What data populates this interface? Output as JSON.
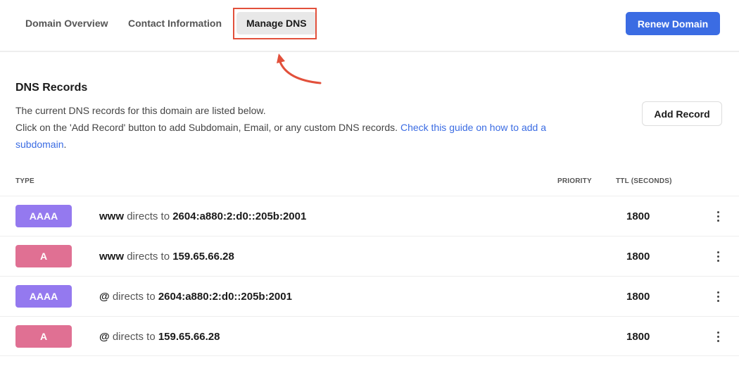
{
  "tabs": [
    {
      "label": "Domain Overview",
      "active": false
    },
    {
      "label": "Contact Information",
      "active": false
    },
    {
      "label": "Manage DNS",
      "active": true
    }
  ],
  "header": {
    "renew_label": "Renew Domain"
  },
  "annotation": {
    "color": "#e2503b",
    "target": "Manage DNS"
  },
  "section": {
    "title": "DNS Records",
    "line1": "The current DNS records for this domain are listed below.",
    "line2": "Click on the 'Add Record' button to add Subdomain, Email, or any custom DNS records.",
    "link": "Check this guide on how to add a subdomain",
    "period": "."
  },
  "add_record_label": "Add Record",
  "table": {
    "columns": {
      "type": "TYPE",
      "priority": "PRIORITY",
      "ttl": "TTL (SECONDS)"
    },
    "rows": [
      {
        "type": "AAAA",
        "type_color": "#9479ef",
        "host": "www",
        "directs": "directs to",
        "value": "2604:a880:2:d0::205b:2001",
        "priority": "",
        "ttl": "1800"
      },
      {
        "type": "A",
        "type_color": "#e07093",
        "host": "www",
        "directs": "directs to",
        "value": "159.65.66.28",
        "priority": "",
        "ttl": "1800"
      },
      {
        "type": "AAAA",
        "type_color": "#9479ef",
        "host": "@",
        "directs": "directs to",
        "value": "2604:a880:2:d0::205b:2001",
        "priority": "",
        "ttl": "1800"
      },
      {
        "type": "A",
        "type_color": "#e07093",
        "host": "@",
        "directs": "directs to",
        "value": "159.65.66.28",
        "priority": "",
        "ttl": "1800"
      }
    ]
  },
  "colors": {
    "accent": "#3b6ce3",
    "aaaa_badge": "#9479ef",
    "a_badge": "#e07093"
  }
}
